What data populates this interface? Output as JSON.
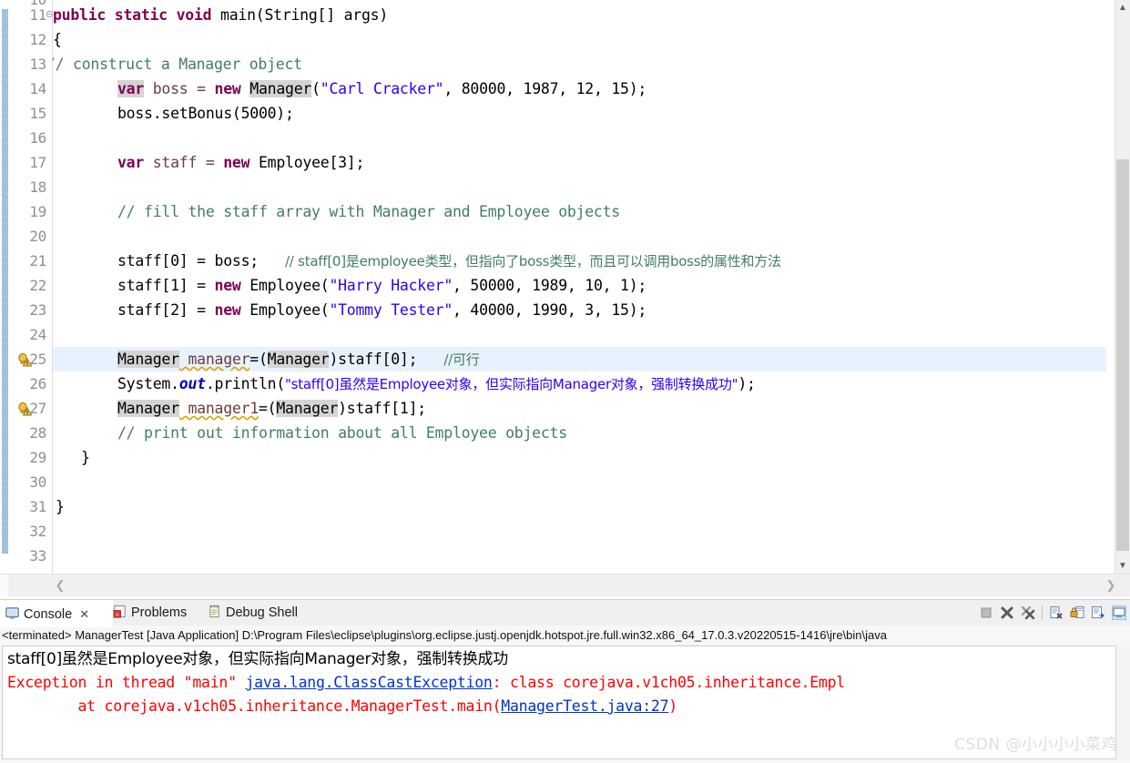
{
  "editor": {
    "first_partial_line": "10",
    "lines": [
      {
        "num": "11",
        "fold": true,
        "warn": false,
        "highlight": false
      },
      {
        "num": "12",
        "fold": false,
        "warn": false,
        "highlight": false
      },
      {
        "num": "13",
        "fold": false,
        "warn": false,
        "highlight": false
      },
      {
        "num": "14",
        "fold": false,
        "warn": false,
        "highlight": false
      },
      {
        "num": "15",
        "fold": false,
        "warn": false,
        "highlight": false
      },
      {
        "num": "16",
        "fold": false,
        "warn": false,
        "highlight": false
      },
      {
        "num": "17",
        "fold": false,
        "warn": false,
        "highlight": false
      },
      {
        "num": "18",
        "fold": false,
        "warn": false,
        "highlight": false
      },
      {
        "num": "19",
        "fold": false,
        "warn": false,
        "highlight": false
      },
      {
        "num": "20",
        "fold": false,
        "warn": false,
        "highlight": false
      },
      {
        "num": "21",
        "fold": false,
        "warn": false,
        "highlight": false
      },
      {
        "num": "22",
        "fold": false,
        "warn": false,
        "highlight": false
      },
      {
        "num": "23",
        "fold": false,
        "warn": false,
        "highlight": false
      },
      {
        "num": "24",
        "fold": false,
        "warn": false,
        "highlight": false
      },
      {
        "num": "25",
        "fold": false,
        "warn": true,
        "highlight": true
      },
      {
        "num": "26",
        "fold": false,
        "warn": false,
        "highlight": false
      },
      {
        "num": "27",
        "fold": false,
        "warn": true,
        "highlight": false
      },
      {
        "num": "28",
        "fold": false,
        "warn": false,
        "highlight": false
      },
      {
        "num": "29",
        "fold": false,
        "warn": false,
        "highlight": false
      },
      {
        "num": "30",
        "fold": false,
        "warn": false,
        "highlight": false
      },
      {
        "num": "31",
        "fold": false,
        "warn": false,
        "highlight": false
      },
      {
        "num": "32",
        "fold": false,
        "warn": false,
        "highlight": false
      },
      {
        "num": "33",
        "fold": false,
        "warn": false,
        "highlight": false
      }
    ],
    "code": {
      "l11": "   public static void main(String[] args)",
      "l12": "   {",
      "l13": "    // construct a Manager object",
      "l14": "         var boss = new Manager(\"Carl Cracker\", 80000, 1987, 12, 15);",
      "l15": "         boss.setBonus(5000);",
      "l17": "         var staff = new Employee[3];",
      "l19": "         // fill the staff array with Manager and Employee objects",
      "l21": "         staff[0] = boss;   // staff[0]是employee类型，但指向了boss类型，而且可以调用boss的属性和方法",
      "l22": "         staff[1] = new Employee(\"Harry Hacker\", 50000, 1989, 10, 1);",
      "l23": "         staff[2] = new Employee(\"Tommy Tester\", 40000, 1990, 3, 15);",
      "l25": "         Manager manager=(Manager)staff[0];   //可行",
      "l26": "         System.out.println(\"staff[0]虽然是Employee对象，但实际指向Manager对象，强制转换成功\");",
      "l27": "         Manager manager1=(Manager)staff[1];",
      "l28": "         // print out information about all Employee objects",
      "l29": "   }",
      "l31": "}",
      "tok": {
        "public": "public",
        "static": "static",
        "void": "void",
        "main_sig": " main(String[] args)",
        "brace_open": "{",
        "brace_close": "}",
        "comment_construct": "// construct a Manager object",
        "var": "var",
        "boss_eq": " boss = ",
        "new": "new",
        "Manager": "Manager",
        "carl_args": "(\"Carl Cracker\", 80000, 1987, 12, 15);",
        "setbonus": "boss.setBonus(5000);",
        "staff_eq": " staff = ",
        "employee_arr": "Employee[3];",
        "comment_fill": "// fill the staff array with Manager and Employee objects",
        "staff0_assign": "staff[0] = boss;   ",
        "comment_staff0": "// staff[0]是employee类型，但指向了boss类型，而且可以调用boss的属性和方法",
        "staff1_assign": "staff[1] = ",
        "harry_open": "Employee(",
        "harry_str": "\"Harry Hacker\"",
        "harry_rest": ", 50000, 1989, 10, 1);",
        "staff2_assign": "staff[2] = ",
        "tommy_open": "Employee(",
        "tommy_str": "\"Tommy Tester\"",
        "tommy_rest": ", 40000, 1990, 3, 15);",
        "manager_var": " manager",
        "cast_eq": "=(",
        "cast_close": ")staff[0];   ",
        "comment_kexing": "//可行",
        "system": "System.",
        "out": "out",
        "println_open": ".println(",
        "print_str": "\"staff[0]虽然是Employee对象，但实际指向Manager对象，强制转换成功\"",
        "println_close": ");",
        "manager1_var": " manager1",
        "cast_close1": ")staff[1];",
        "comment_print": "// print out information about all Employee objects"
      }
    }
  },
  "console": {
    "tabs": [
      {
        "label": "Console",
        "icon": "console-icon",
        "active": true,
        "closable": true
      },
      {
        "label": "Problems",
        "icon": "problems-icon",
        "active": false,
        "closable": false
      },
      {
        "label": "Debug Shell",
        "icon": "debug-shell-icon",
        "active": false,
        "closable": false
      }
    ],
    "launch_line": "<terminated> ManagerTest [Java Application] D:\\Program Files\\eclipse\\plugins\\org.eclipse.justj.openjdk.hotspot.jre.full.win32.x86_64_17.0.3.v20220515-1416\\jre\\bin\\java",
    "output": [
      {
        "text": "staff[0]虽然是Employee对象，但实际指向Manager对象，强制转换成功",
        "color": "black"
      },
      {
        "pre": "Exception in thread \"main\" ",
        "link": "java.lang.ClassCastException",
        "post": ": class corejava.v1ch05.inheritance.Empl",
        "color": "red"
      },
      {
        "pre": "        at corejava.v1ch05.inheritance.ManagerTest.main(",
        "link": "ManagerTest.java:27",
        "post": ")",
        "color": "red"
      }
    ],
    "toolbar_icons": [
      "terminate-icon",
      "remove-launch-icon",
      "remove-all-terminated-icon",
      "clear-console-icon",
      "scroll-lock-icon",
      "pin-console-icon",
      "display-console-icon"
    ]
  },
  "watermark": "CSDN @小小小小菜鸡",
  "colors": {
    "keyword": "#7f0055",
    "comment": "#3f7f5f",
    "string": "#2a00ff",
    "field": "#0000c0",
    "occurrence_bg": "#d4d4d4",
    "highlight_row": "#e8f2fe",
    "error_red": "#ff0000",
    "link_blue": "#0033cc",
    "changebar": "#3c7fb1"
  }
}
